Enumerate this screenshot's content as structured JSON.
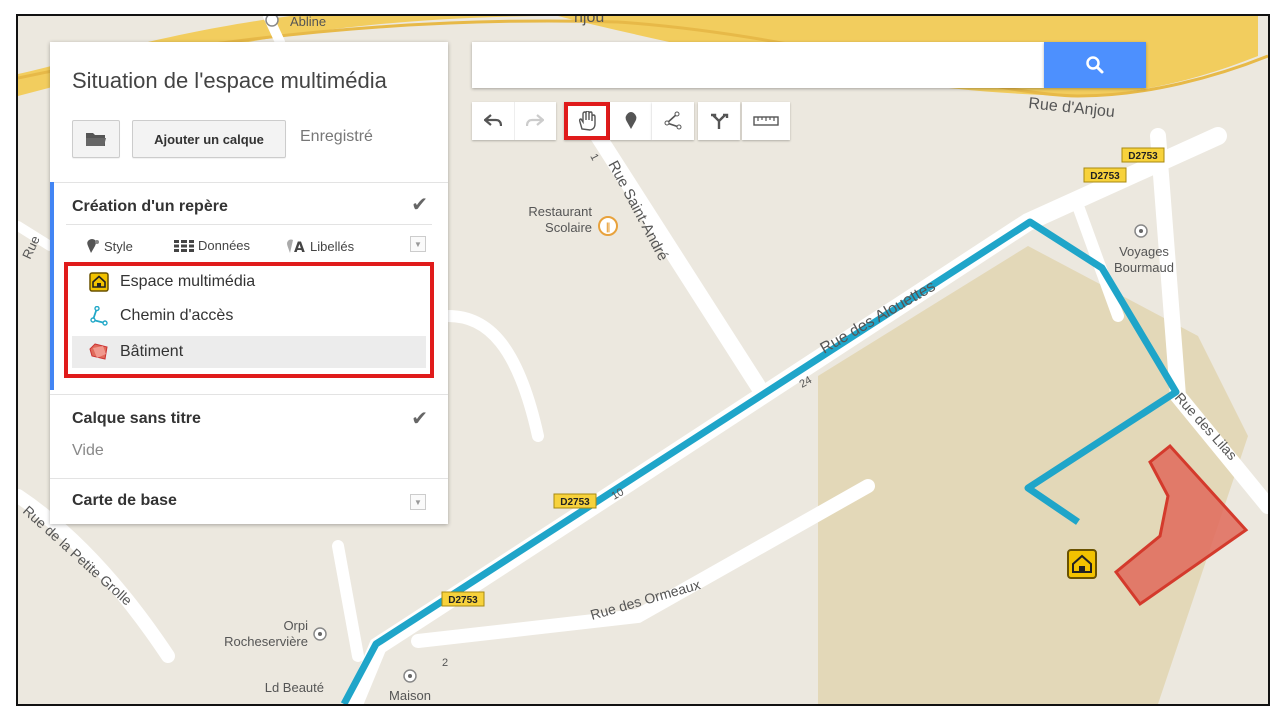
{
  "panel": {
    "title": "Situation de l'espace multimédia",
    "add_layer_label": "Ajouter un calque",
    "save_status": "Enregistré",
    "layers": [
      {
        "title": "Création d'un repère",
        "checked": true,
        "options": [
          {
            "label": "Style",
            "icon": "paint-marker-icon"
          },
          {
            "label": "Données",
            "icon": "grid-icon"
          },
          {
            "label": "Libellés",
            "icon": "label-icon"
          }
        ],
        "items": [
          {
            "label": "Espace multimédia",
            "icon": "home-marker-icon",
            "color": "#f2c200"
          },
          {
            "label": "Chemin d'accès",
            "icon": "path-icon",
            "color": "#22a8c8"
          },
          {
            "label": "Bâtiment",
            "icon": "polygon-icon",
            "color": "#e06a5a"
          }
        ]
      },
      {
        "title": "Calque sans titre",
        "checked": true,
        "subtitle": "Vide"
      },
      {
        "title": "Carte de base"
      }
    ]
  },
  "search": {
    "placeholder": "",
    "value": ""
  },
  "map": {
    "streets": [
      "Rue d'Anjou",
      "Rue Saint-André",
      "Rue des Alouettes",
      "Rue des Lilas",
      "Rue des Ormeaux",
      "Rue de la Petite Grolle"
    ],
    "road_shields": [
      "D2753",
      "D2753",
      "D2753",
      "D2753"
    ],
    "places": [
      "Abline",
      "Restaurant",
      "Scolaire",
      "Voyages",
      "Bourmaud",
      "Orpi",
      "Rocheservière",
      "Ld Beauté",
      "Maison"
    ],
    "numbers": [
      "1",
      "24",
      "10",
      "2"
    ],
    "partial_labels": [
      "njou",
      "Rue"
    ]
  },
  "colors": {
    "route": "#1fa5c9",
    "building": "#e06a5a",
    "highlight": "#e01b1b",
    "search_button": "#4d90fe",
    "layer_accent": "#4285f4"
  }
}
